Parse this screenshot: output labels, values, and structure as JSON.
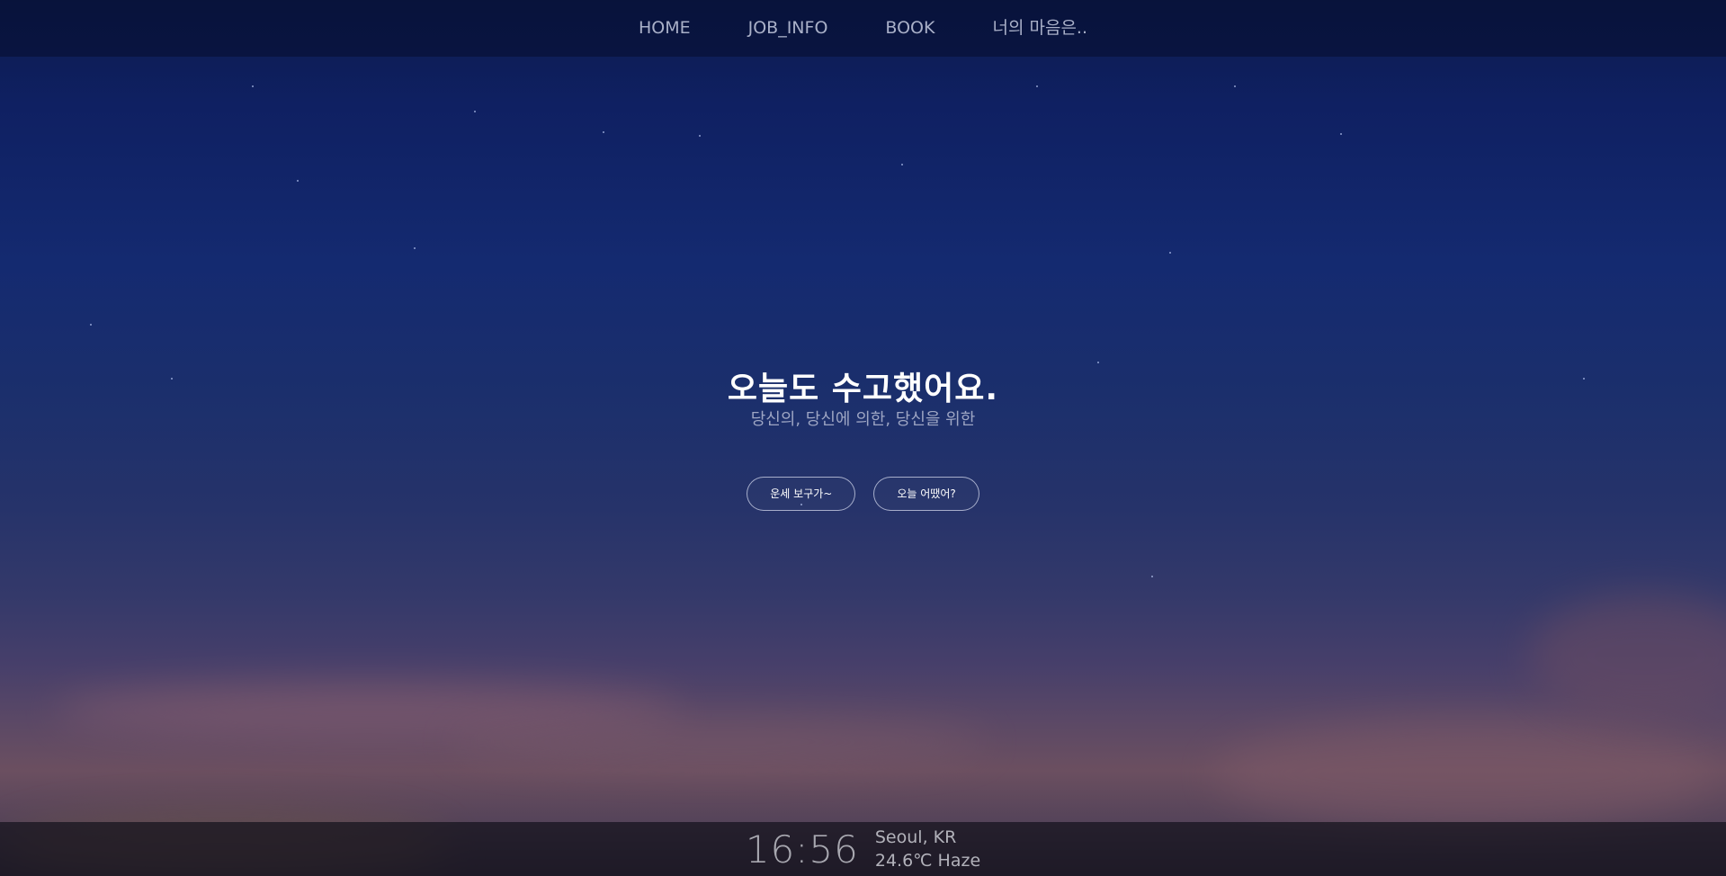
{
  "nav": {
    "items": [
      {
        "label": "HOME"
      },
      {
        "label": "JOB_INFO"
      },
      {
        "label": "BOOK"
      },
      {
        "label": "너의 마음은.."
      }
    ]
  },
  "hero": {
    "title": "오늘도 수고했어요.",
    "subtitle": "당신의, 당신에 의한, 당신을 위한",
    "buttons": [
      {
        "label": "운세 보구가~"
      },
      {
        "label": "오늘 어땠어?"
      }
    ]
  },
  "footer": {
    "time": "16:56",
    "location": "Seoul, KR",
    "weather": "24.6℃ Haze"
  },
  "colors": {
    "sky_top": "#0d1b4d",
    "sky_bottom": "#6b4f60",
    "nav_text": "#a9b0c8",
    "title_text": "#ffffff",
    "subtitle_text": "#9ea6c4"
  }
}
